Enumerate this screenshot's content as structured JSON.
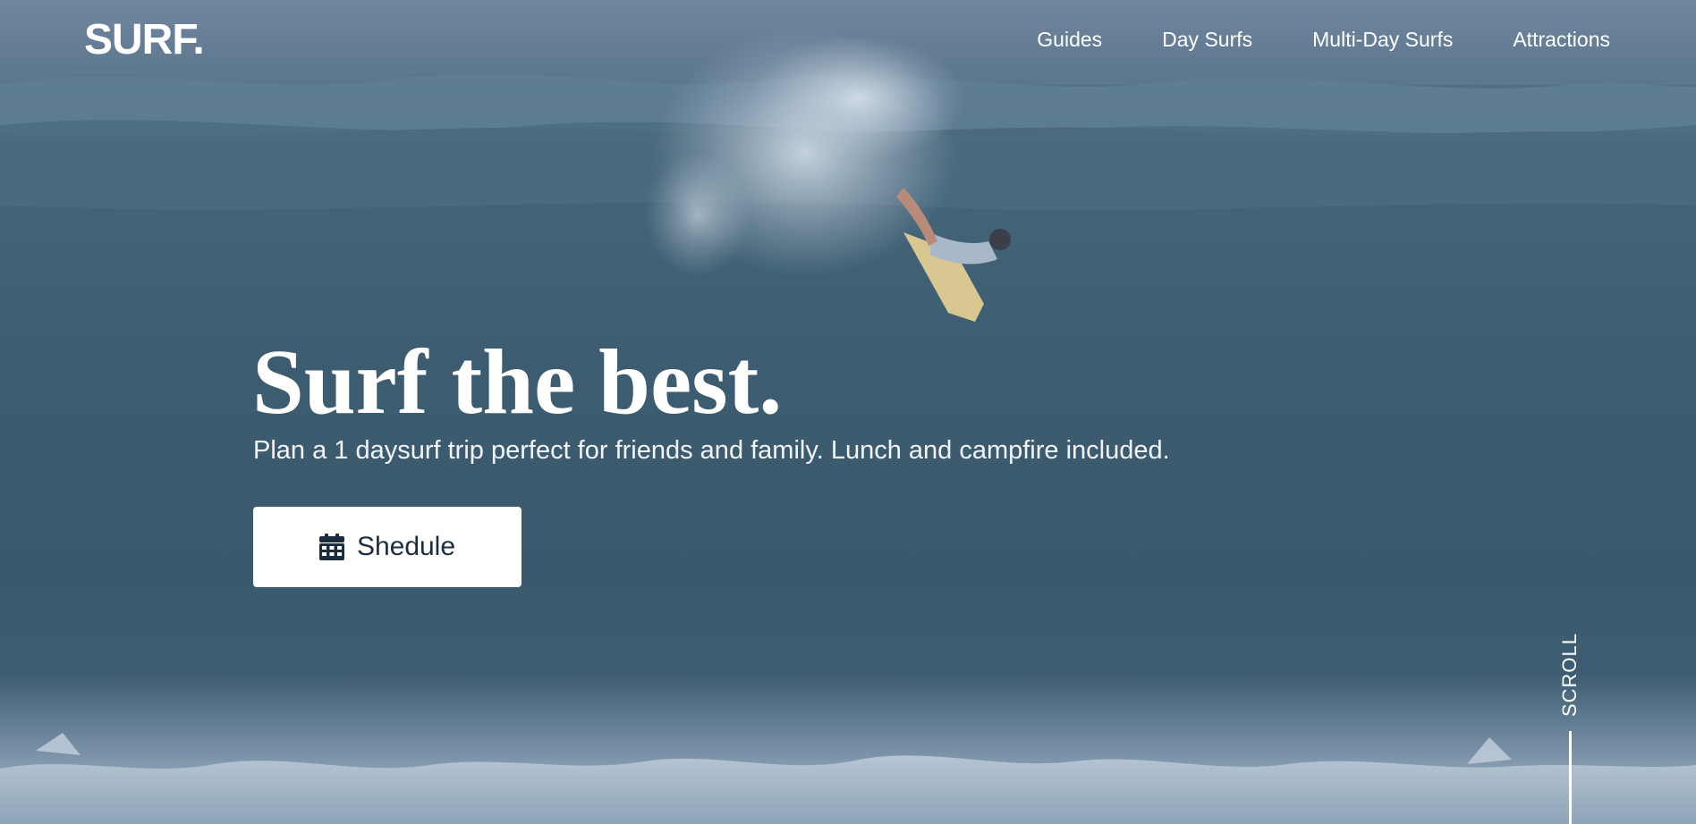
{
  "brand": {
    "logo": "SURF."
  },
  "nav": {
    "items": [
      {
        "label": "Guides"
      },
      {
        "label": "Day Surfs"
      },
      {
        "label": "Multi-Day Surfs"
      },
      {
        "label": "Attractions"
      }
    ]
  },
  "hero": {
    "title": "Surf the best.",
    "subtitle": "Plan a 1 daysurf trip perfect for friends and family. Lunch and campfire included.",
    "cta": {
      "label": "Shedule",
      "icon": "calendar-icon"
    },
    "scroll_label": "SCROLL",
    "background": "ocean wave with surfer photo"
  },
  "colors": {
    "overlay": "#3d5c70",
    "button_bg": "#ffffff",
    "button_text": "#1d2d40",
    "text": "#ffffff"
  }
}
